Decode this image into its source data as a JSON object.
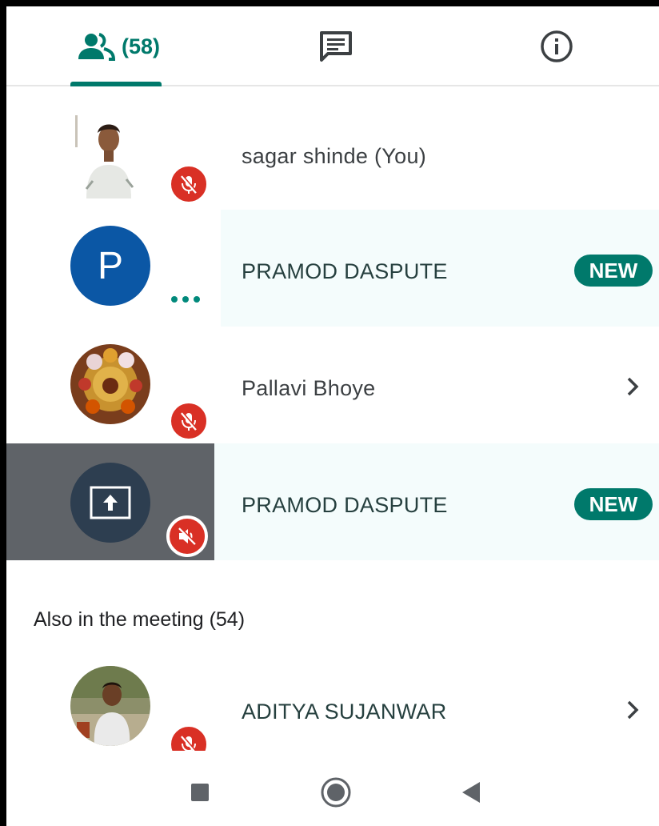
{
  "tabs": {
    "people_count": "(58)"
  },
  "participants": [
    {
      "name": "sagar shinde (You)"
    },
    {
      "name": "PRAMOD DASPUTE",
      "avatar_letter": "P",
      "badge": "NEW"
    },
    {
      "name": "Pallavi Bhoye"
    },
    {
      "name": "PRAMOD DASPUTE",
      "badge": "NEW"
    }
  ],
  "section": {
    "title": "Also in the meeting (54)"
  },
  "also_in_meeting": [
    {
      "name": "ADITYA SUJANWAR"
    }
  ],
  "colors": {
    "accent": "#00796b",
    "muted_red": "#d93025",
    "avatar_blue": "#0b57a5",
    "screen_share_bg": "#5f6368",
    "screen_share_circle": "#2d3e50",
    "highlight_row": "#f4fcfc"
  },
  "icons": {
    "people_tab": "people-icon",
    "chat_tab": "chat-icon",
    "info_tab": "info-icon",
    "mic_off": "mic-off-icon",
    "audio_off": "volume-off-icon",
    "present": "present-screen-icon",
    "chevron": "chevron-right-icon",
    "more": "more-dots-icon"
  },
  "navbar": {
    "buttons": [
      "recents",
      "home",
      "back"
    ]
  }
}
